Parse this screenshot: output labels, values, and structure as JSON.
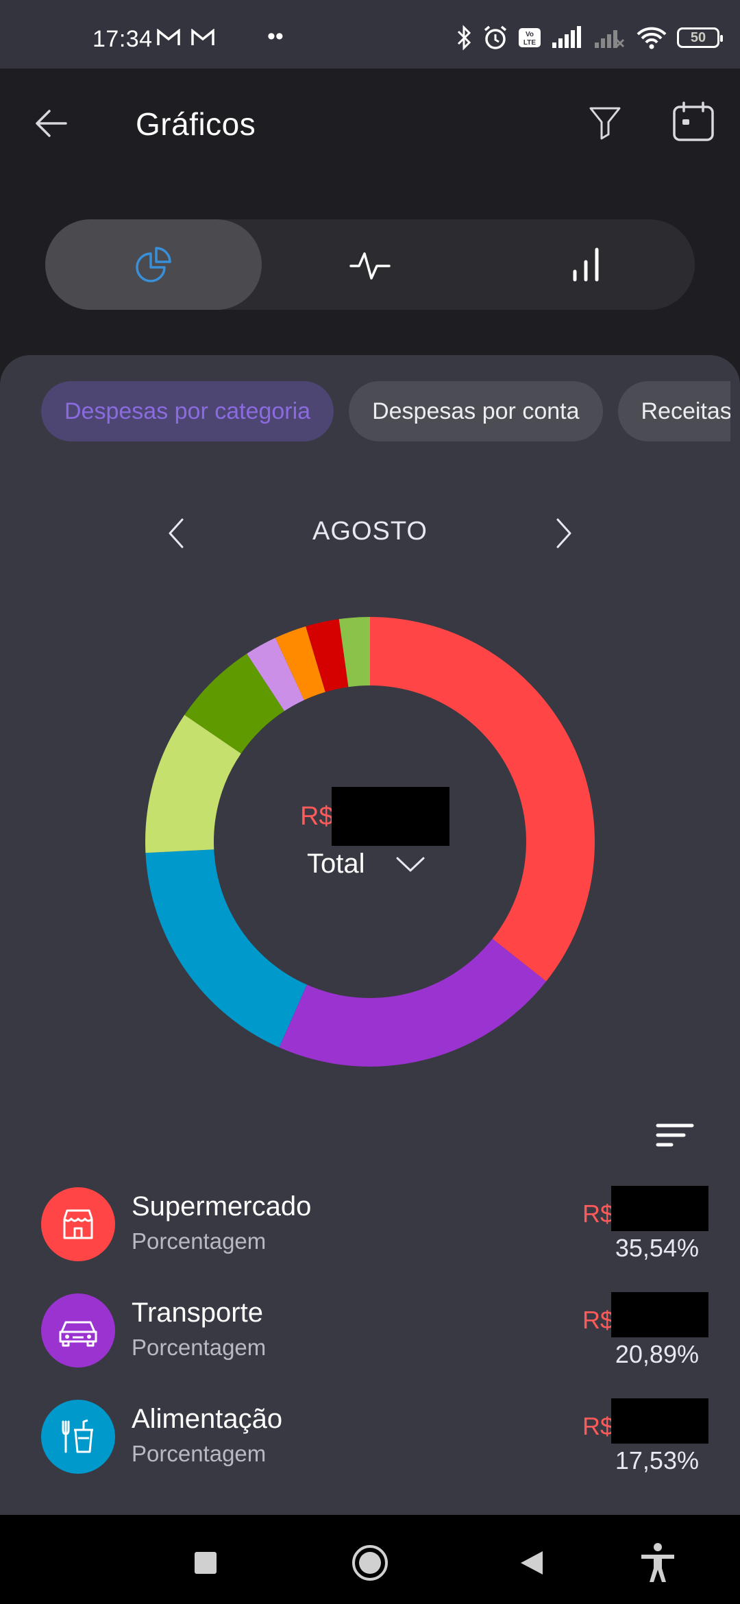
{
  "status": {
    "time": "17:34",
    "battery": "50"
  },
  "header": {
    "title": "Gráficos"
  },
  "chart_switch": {
    "options": [
      "pie-chart",
      "line-chart",
      "bar-chart"
    ],
    "active": 0
  },
  "chips": [
    {
      "label": "Despesas por categoria",
      "active": true
    },
    {
      "label": "Despesas por conta",
      "active": false
    },
    {
      "label": "Receitas por categoria",
      "active": false
    }
  ],
  "period": {
    "month": "AGOSTO"
  },
  "summary": {
    "currency_prefix": "R$",
    "total_label": "Total"
  },
  "chart_data": {
    "type": "pie",
    "values_percent": [
      35.54,
      20.89,
      17.53,
      10.3,
      6.2,
      2.3,
      2.3,
      2.4,
      2.2
    ],
    "colors": [
      "#ff4545",
      "#9b33d1",
      "#0099cc",
      "#c5e06c",
      "#5f9a00",
      "#cc8fe8",
      "#ff8a00",
      "#d50000",
      "#8bc34a"
    ],
    "labels_shown": [
      "Supermercado",
      "Transporte",
      "Alimentação"
    ]
  },
  "categories": [
    {
      "name": "Supermercado",
      "sub": "Porcentagem",
      "prefix": "R$",
      "percent": "35,54%",
      "color": "#ff4545",
      "icon": "store-icon"
    },
    {
      "name": "Transporte",
      "sub": "Porcentagem",
      "prefix": "R$",
      "percent": "20,89%",
      "color": "#9b33d1",
      "icon": "car-icon"
    },
    {
      "name": "Alimentação",
      "sub": "Porcentagem",
      "prefix": "R$",
      "percent": "17,53%",
      "color": "#0099cc",
      "icon": "food-icon"
    }
  ]
}
